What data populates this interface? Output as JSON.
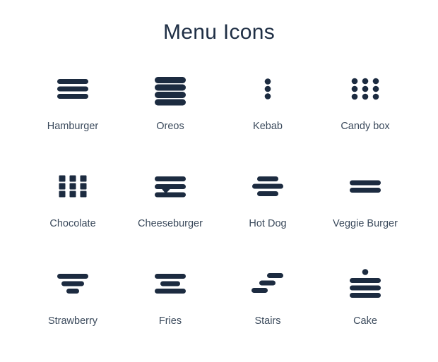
{
  "page": {
    "title": "Menu Icons",
    "background_color": "#ffffff",
    "title_color": "#1e2e44",
    "icon_color": "#1c2b40",
    "label_color": "#3b4a5c"
  },
  "icons": [
    {
      "label": "Hamburger",
      "icon_name": "hamburger-menu-icon",
      "shape": "three-equal-bars"
    },
    {
      "label": "Oreos",
      "icon_name": "oreos-menu-icon",
      "shape": "four-thick-stacked-bars"
    },
    {
      "label": "Kebab",
      "icon_name": "kebab-menu-icon",
      "shape": "three-vertical-dots"
    },
    {
      "label": "Candy box",
      "icon_name": "candy-box-menu-icon",
      "shape": "three-by-three-dot-grid"
    },
    {
      "label": "Chocolate",
      "icon_name": "chocolate-menu-icon",
      "shape": "three-by-three-square-grid"
    },
    {
      "label": "Cheeseburger",
      "icon_name": "cheeseburger-menu-icon",
      "shape": "three-bars-with-cheese-drip"
    },
    {
      "label": "Hot Dog",
      "icon_name": "hot-dog-menu-icon",
      "shape": "short-long-short-bars"
    },
    {
      "label": "Veggie Burger",
      "icon_name": "veggie-burger-menu-icon",
      "shape": "two-bars"
    },
    {
      "label": "Strawberry",
      "icon_name": "strawberry-menu-icon",
      "shape": "three-tapered-centered-bars"
    },
    {
      "label": "Fries",
      "icon_name": "fries-menu-icon",
      "shape": "long-short-long-bars"
    },
    {
      "label": "Stairs",
      "icon_name": "stairs-menu-icon",
      "shape": "three-offset-diagonal-bars"
    },
    {
      "label": "Cake",
      "icon_name": "cake-menu-icon",
      "shape": "dot-over-three-bars"
    }
  ]
}
